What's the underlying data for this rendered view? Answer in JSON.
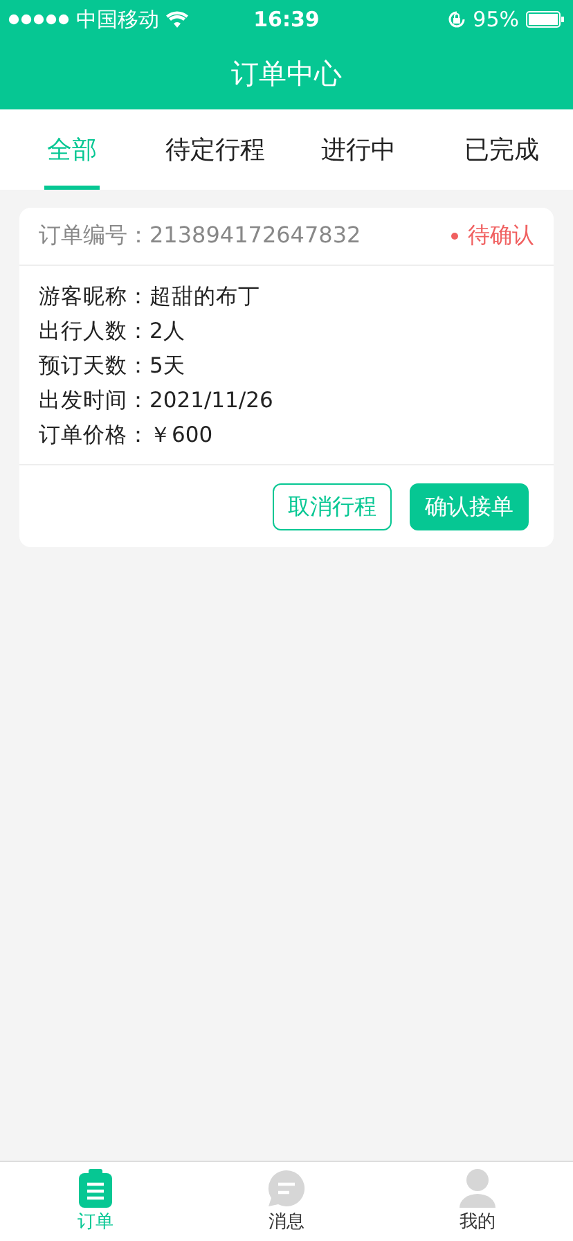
{
  "status_bar": {
    "carrier": "中国移动",
    "time": "16:39",
    "battery": "95%"
  },
  "header": {
    "title": "订单中心"
  },
  "tabs": [
    {
      "label": "全部",
      "selected": true
    },
    {
      "label": "待定行程",
      "selected": false
    },
    {
      "label": "进行中",
      "selected": false
    },
    {
      "label": "已完成",
      "selected": false
    }
  ],
  "orders": [
    {
      "number": "订单编号：213894172647832",
      "status": "待确认",
      "fields": [
        {
          "label": "游客昵称：",
          "value": "超甜的布丁"
        },
        {
          "label": "出行人数：",
          "value": "2人"
        },
        {
          "label": "预订天数：",
          "value": "5天"
        },
        {
          "label": "出发时间：",
          "value": "2021/11/26"
        },
        {
          "label": "订单价格：",
          "value": "￥600"
        }
      ],
      "buttons": [
        {
          "label": "取消行程",
          "kind": "outline"
        },
        {
          "label": "确认接单",
          "kind": "primary"
        }
      ]
    }
  ],
  "bottom_nav": [
    {
      "label": "订单",
      "selected": true
    },
    {
      "label": "消息",
      "selected": false
    },
    {
      "label": "我的",
      "selected": false
    }
  ]
}
